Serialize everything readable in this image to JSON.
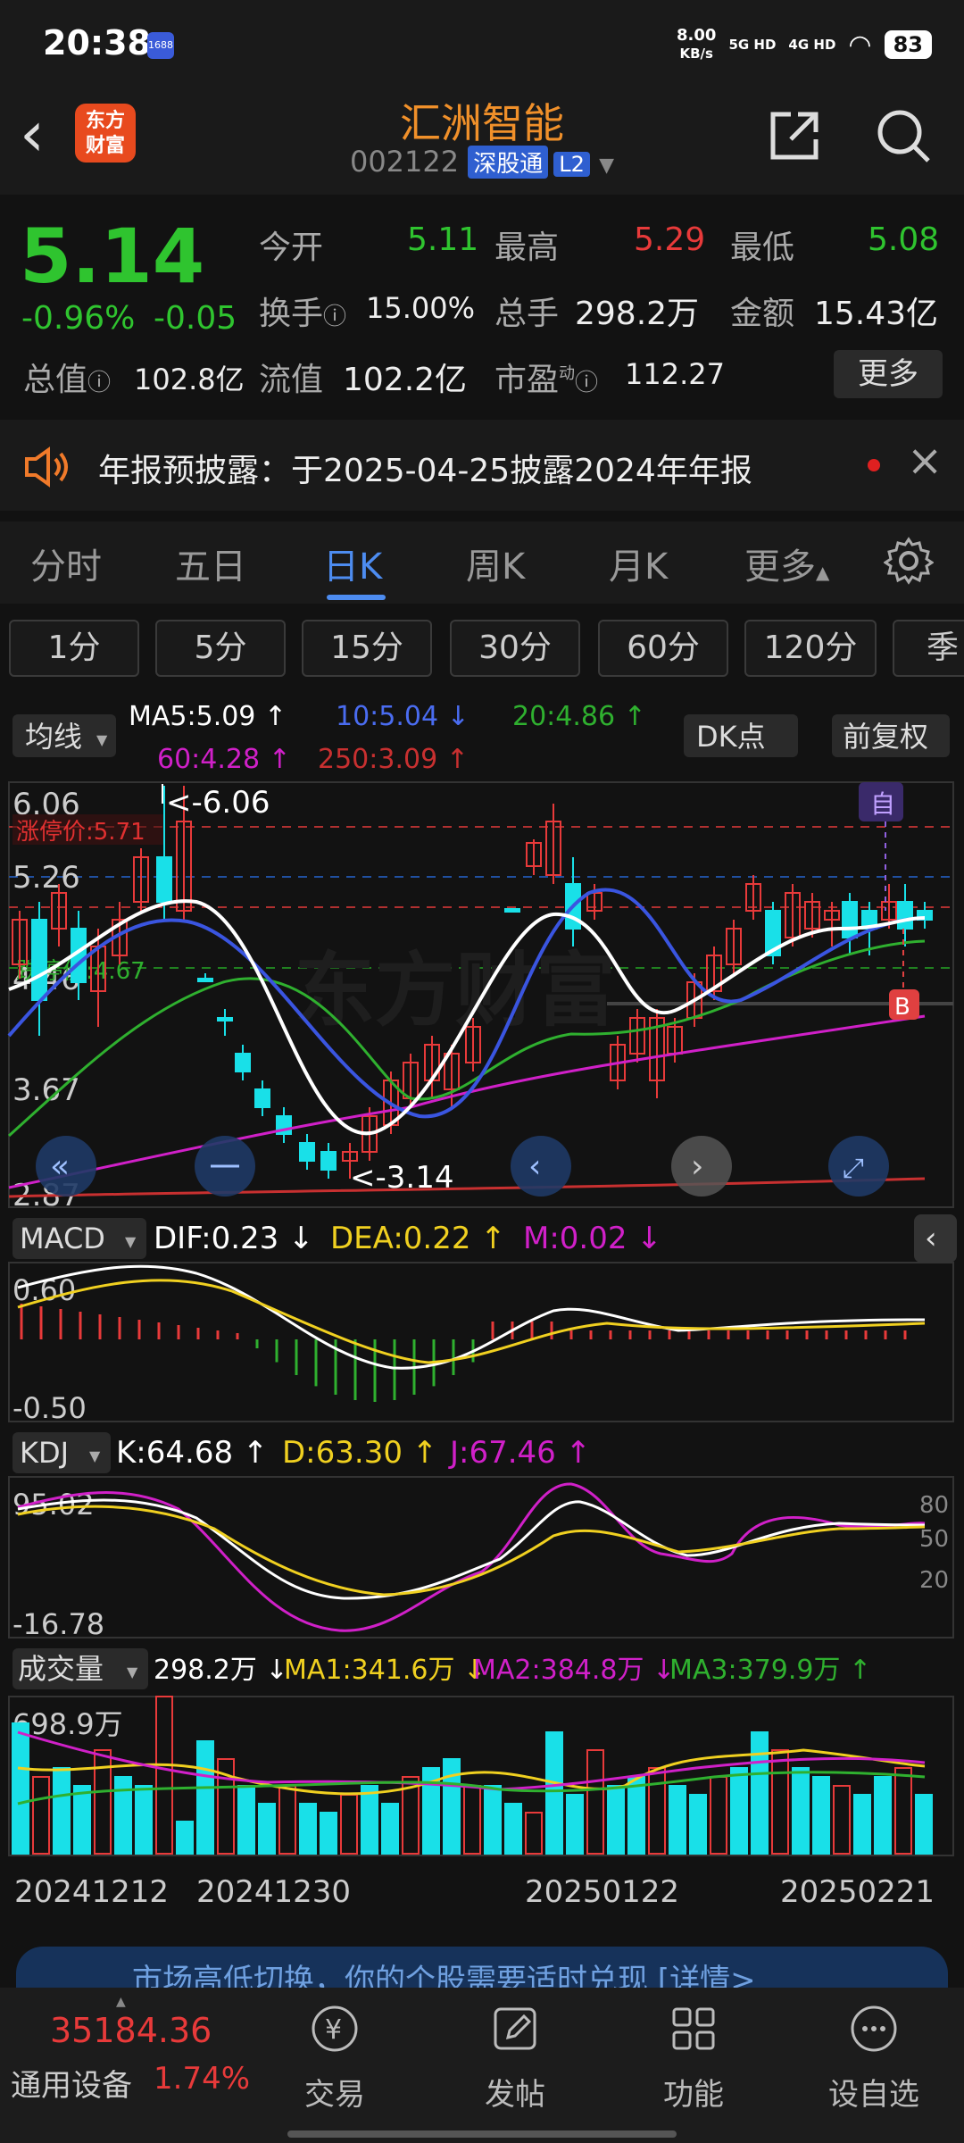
{
  "status": {
    "time": "20:38",
    "badge": "1688",
    "net_speed": "8.00",
    "net_unit": "KB/s",
    "sig1": "5G HD",
    "sig2": "4G HD",
    "battery": "83"
  },
  "header": {
    "name": "汇洲智能",
    "code": "002122",
    "tag_market": "深股通",
    "tag_level": "L2",
    "logo_text": "东方财富"
  },
  "quote": {
    "price": "5.14",
    "pct": "-0.96%",
    "chg": "-0.05",
    "open_label": "今开",
    "open": "5.11",
    "high_label": "最高",
    "high": "5.29",
    "low_label": "最低",
    "low": "5.08",
    "turnover_label": "换手",
    "turnover": "15.00%",
    "volume_label": "总手",
    "volume": "298.2万",
    "amount_label": "金额",
    "amount": "15.43亿",
    "mcap_label": "总值",
    "mcap": "102.8亿",
    "float_label": "流值",
    "float_mcap": "102.2亿",
    "pe_label": "市盈",
    "pe_sup": "动",
    "pe": "112.27",
    "more": "更多"
  },
  "notice": {
    "text": "年报预披露：于2025-04-25披露2024年年报"
  },
  "tabs": [
    "分时",
    "五日",
    "日K",
    "周K",
    "月K",
    "更多"
  ],
  "active_tab": "日K",
  "periods": [
    "1分",
    "5分",
    "15分",
    "30分",
    "60分",
    "120分",
    "季"
  ],
  "main_chart": {
    "indicator_btn": "均线",
    "ma5": "MA5:5.09 ↑",
    "ma10": "10:5.04 ↓",
    "ma20": "20:4.86 ↑",
    "ma60": "60:4.28 ↑",
    "ma250": "250:3.09 ↑",
    "dk_btn": "DK点",
    "fq_btn": "前复权",
    "y_labels": [
      "6.06",
      "5.26",
      "4.46",
      "3.67",
      "2.87"
    ],
    "limit_up": "涨停价:5.71",
    "limit_down": "跌停价:4.67",
    "max_mark": "<-6.06",
    "min_mark": "<-3.14",
    "self_tag": "自",
    "buy_tag": "B",
    "watermark": "东方财富"
  },
  "chart_data": {
    "type": "candlestick",
    "dates_shown": [
      "20241212",
      "20241230",
      "20250122",
      "20250221"
    ],
    "high": 6.06,
    "low": 3.14,
    "last_close": 5.14,
    "ylim": [
      2.87,
      6.06
    ]
  },
  "macd": {
    "btn": "MACD",
    "dif": "DIF:0.23 ↓",
    "dea": "DEA:0.22 ↑",
    "m": "M:0.02 ↓",
    "ymax": "0.60",
    "ymin": "-0.50"
  },
  "kdj": {
    "btn": "KDJ",
    "k": "K:64.68 ↑",
    "d": "D:63.30 ↑",
    "j": "J:67.46 ↑",
    "ymax": "95.02",
    "ymin": "-16.78",
    "lv80": "80",
    "lv50": "50",
    "lv20": "20"
  },
  "vol": {
    "btn": "成交量",
    "vol": "298.2万 ↓",
    "ma1": "MA1:341.6万 ↓",
    "ma2": "MA2:384.8万 ↓",
    "ma3": "MA3:379.9万 ↑",
    "ymax": "698.9万"
  },
  "banner": {
    "text": "市场高低切换，你的个股需要适时兑现 [详情>"
  },
  "bottom": {
    "index_val": "35184.36",
    "index_name": "通用设备",
    "index_chg": "1.74%",
    "nav": [
      "交易",
      "发帖",
      "功能",
      "设自选"
    ]
  }
}
